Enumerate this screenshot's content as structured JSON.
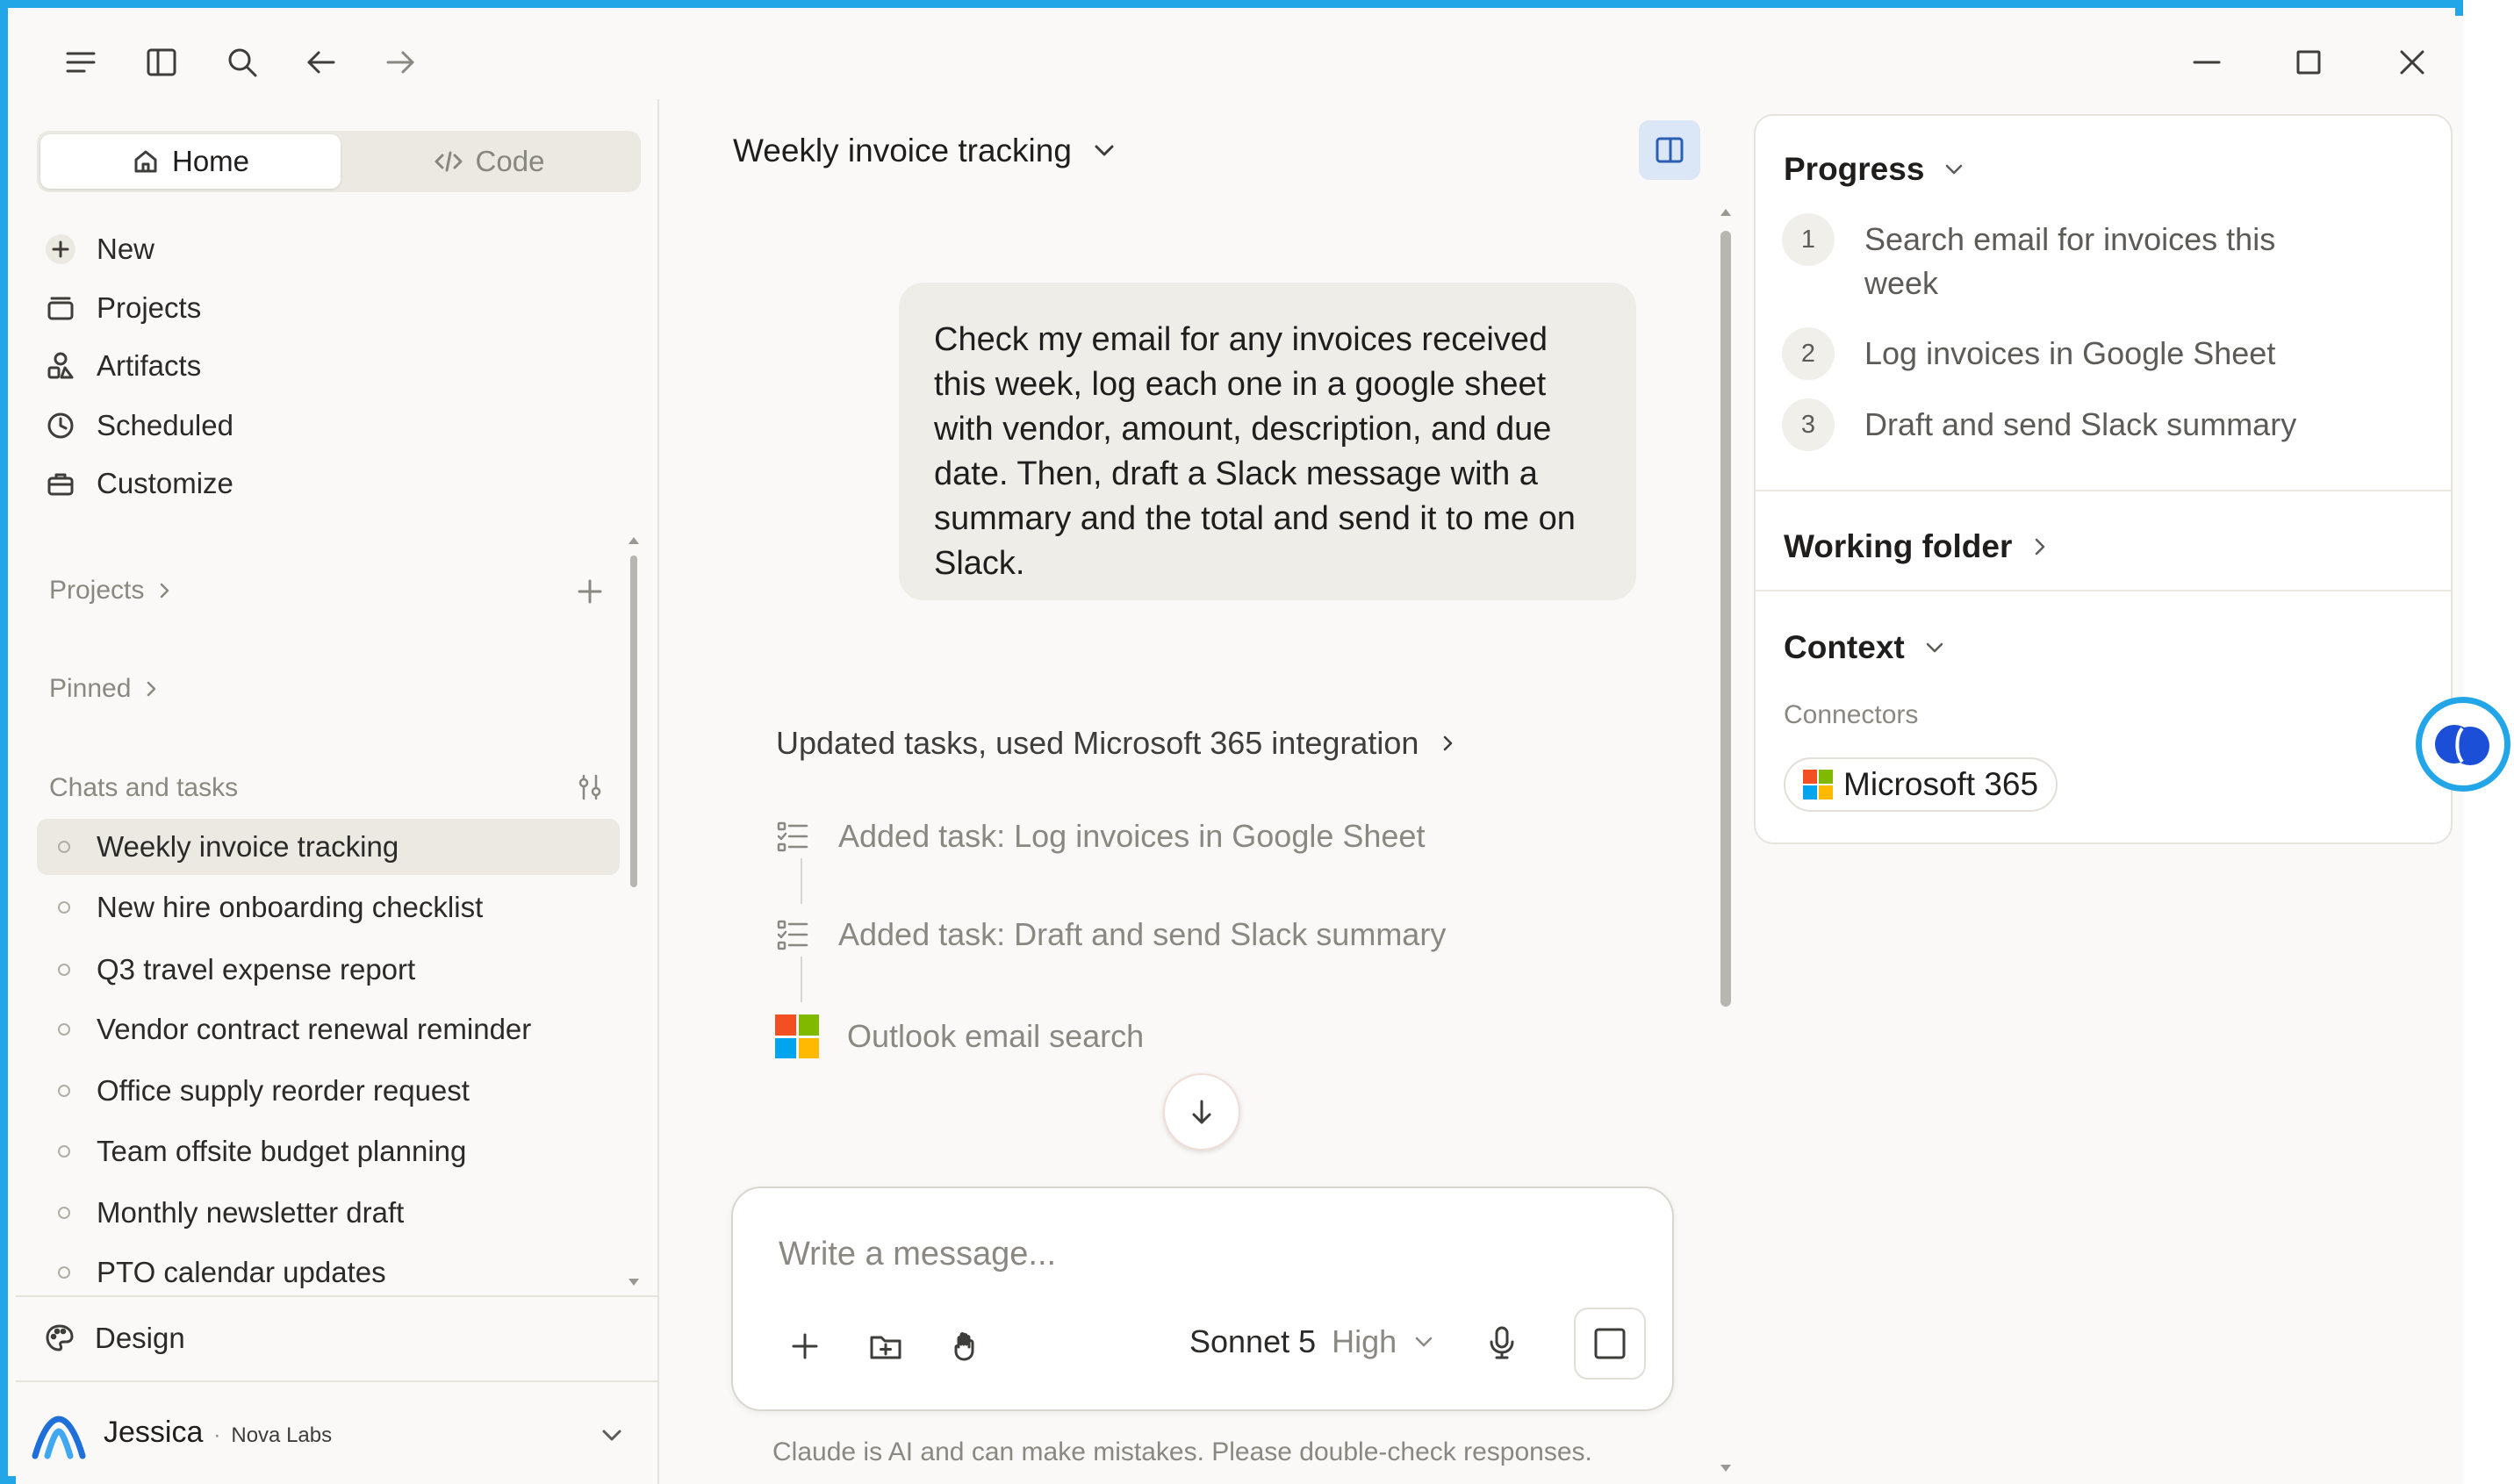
{
  "sidebar": {
    "tabs": {
      "home": "Home",
      "code": "Code"
    },
    "nav": [
      {
        "label": "New",
        "icon": "plus-icon"
      },
      {
        "label": "Projects",
        "icon": "projects-icon"
      },
      {
        "label": "Artifacts",
        "icon": "artifacts-icon"
      },
      {
        "label": "Scheduled",
        "icon": "clock-icon"
      },
      {
        "label": "Customize",
        "icon": "briefcase-icon"
      }
    ],
    "sections": {
      "projects": "Projects",
      "pinned": "Pinned",
      "chats": "Chats and tasks"
    },
    "chats": [
      "Weekly invoice tracking",
      "New hire onboarding checklist",
      "Q3 travel expense report",
      "Vendor contract renewal reminder",
      "Office supply reorder request",
      "Team offsite budget planning",
      "Monthly newsletter draft",
      "PTO calendar updates"
    ],
    "design": "Design",
    "user": {
      "name": "Jessica",
      "sep": "·",
      "org": "Nova Labs"
    }
  },
  "main": {
    "chat_title": "Weekly invoice tracking",
    "user_message": "Check my email for any invoices received this week, log each one in a google sheet with vendor, amount, description, and due date. Then, draft a Slack message with a summary and the total and send it to me on Slack.",
    "tool_summary": "Updated tasks, used Microsoft 365 integration",
    "steps": [
      "Added task: Log invoices in Google Sheet",
      "Added task: Draft and send Slack summary",
      "Outlook email search"
    ],
    "composer": {
      "placeholder": "Write a message...",
      "model": "Sonnet 5",
      "effort": "High"
    },
    "disclaimer": "Claude is AI and can make mistakes. Please double-check responses."
  },
  "right_panel": {
    "progress_title": "Progress",
    "progress": [
      {
        "num": "1",
        "text": "Search email for invoices this week"
      },
      {
        "num": "2",
        "text": "Log invoices in Google Sheet"
      },
      {
        "num": "3",
        "text": "Draft and send Slack summary"
      }
    ],
    "working_folder": "Working folder",
    "context_title": "Context",
    "connectors_label": "Connectors",
    "connector": "Microsoft 365"
  },
  "colors": {
    "accent_border": "#22a6e8",
    "active_toggle": "#dbe6f6",
    "ms_red": "#f25022",
    "ms_green": "#7fba00",
    "ms_blue": "#00a4ef",
    "ms_yellow": "#ffb900"
  }
}
